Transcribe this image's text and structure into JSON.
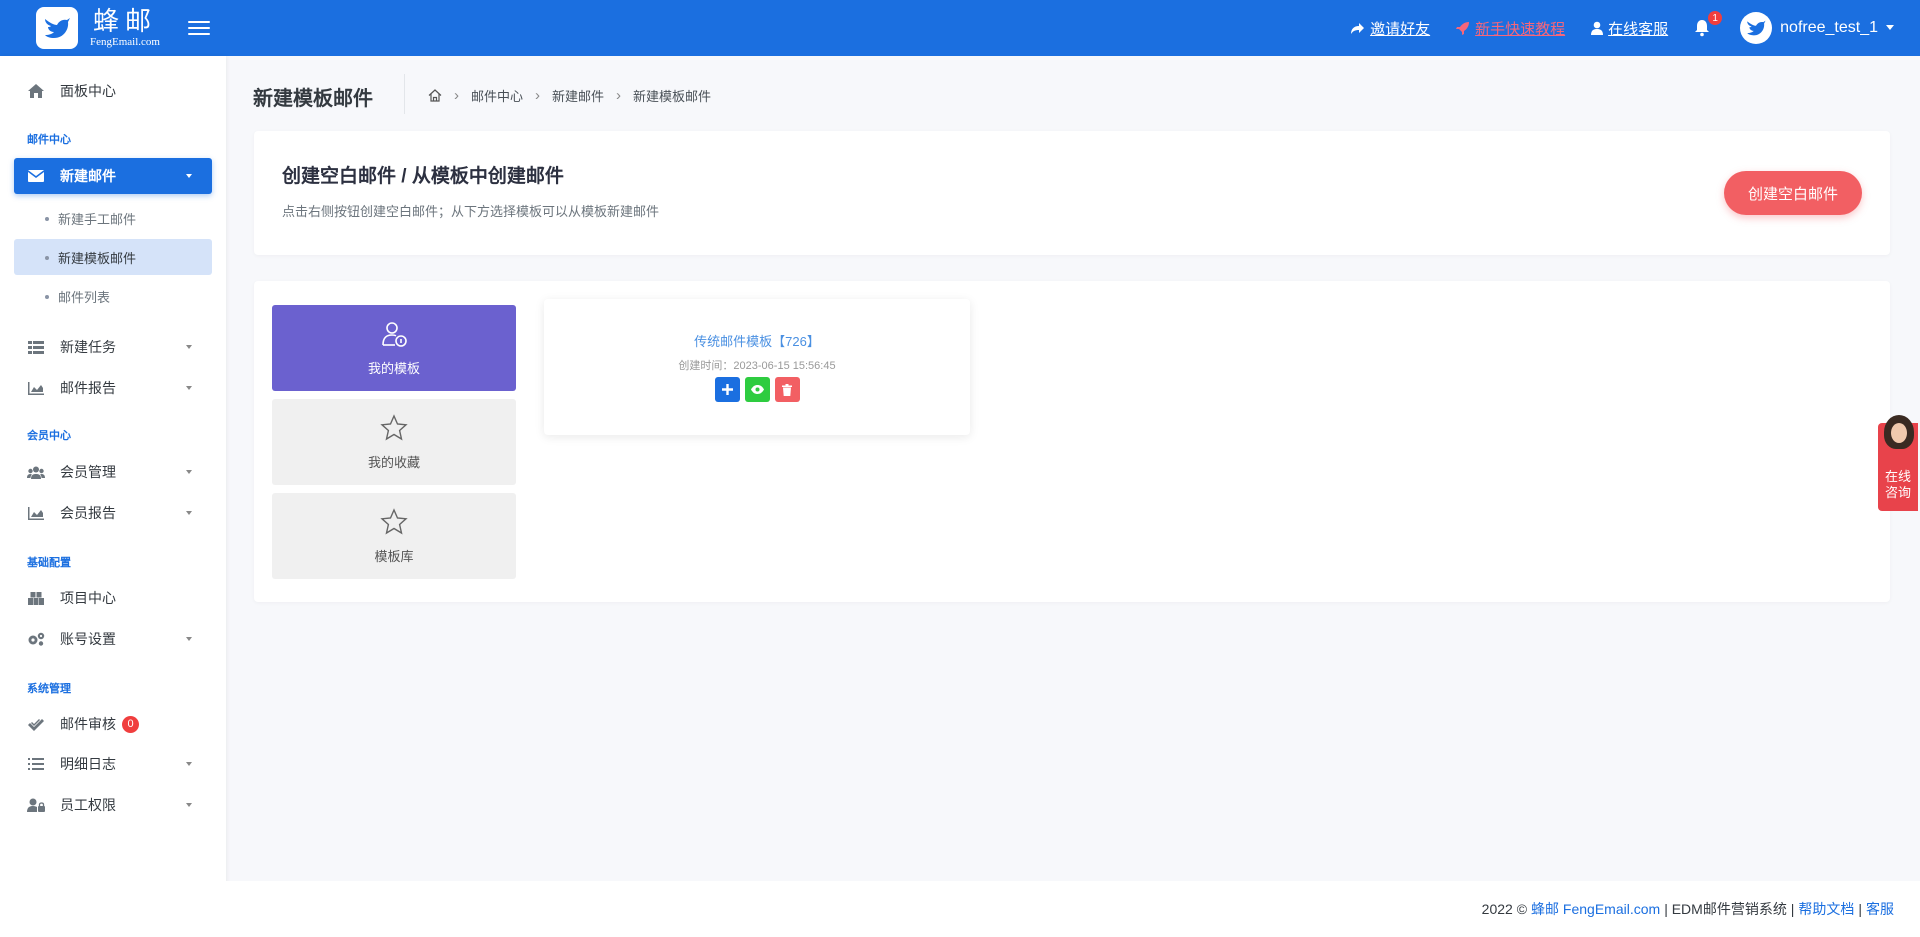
{
  "header": {
    "brand_name": "蜂邮",
    "brand_sub": "FengEmail.com",
    "links": {
      "invite": "邀请好友",
      "tutorial": "新手快速教程",
      "support": "在线客服"
    },
    "notification_count": "1",
    "username": "nofree_test_1",
    "accent_color": "#1b6fe0"
  },
  "sidebar": {
    "dashboard": "面板中心",
    "section_mail": "邮件中心",
    "new_mail": "新建邮件",
    "sub_manual": "新建手工邮件",
    "sub_template": "新建模板邮件",
    "sub_list": "邮件列表",
    "new_task": "新建任务",
    "mail_report": "邮件报告",
    "section_member": "会员中心",
    "member_manage": "会员管理",
    "member_report": "会员报告",
    "section_basic": "基础配置",
    "project_center": "项目中心",
    "account_settings": "账号设置",
    "section_system": "系统管理",
    "mail_review": "邮件审核",
    "mail_review_badge": "0",
    "detail_log": "明细日志",
    "staff_permission": "员工权限"
  },
  "page": {
    "title": "新建模板邮件",
    "breadcrumb": [
      "邮件中心",
      "新建邮件",
      "新建模板邮件"
    ]
  },
  "create_card": {
    "title": "创建空白邮件 / 从模板中创建邮件",
    "description": "点击右侧按钮创建空白邮件；从下方选择模板可以从模板新建邮件",
    "button": "创建空白邮件"
  },
  "tabs": {
    "my_templates": "我的模板",
    "my_favorites": "我的收藏",
    "template_library": "模板库"
  },
  "template_card": {
    "name": "传统邮件模板【726】",
    "created": "创建时间：2023-06-15 15:56:45"
  },
  "footer": {
    "prefix": "2022 ©",
    "brand_link": "蜂邮 FengEmail.com",
    "system": "| EDM邮件营销系统 |",
    "help": "帮助文档",
    "sep": "|",
    "service": "客服"
  },
  "consult": {
    "line1": "在线",
    "line2": "咨询"
  }
}
